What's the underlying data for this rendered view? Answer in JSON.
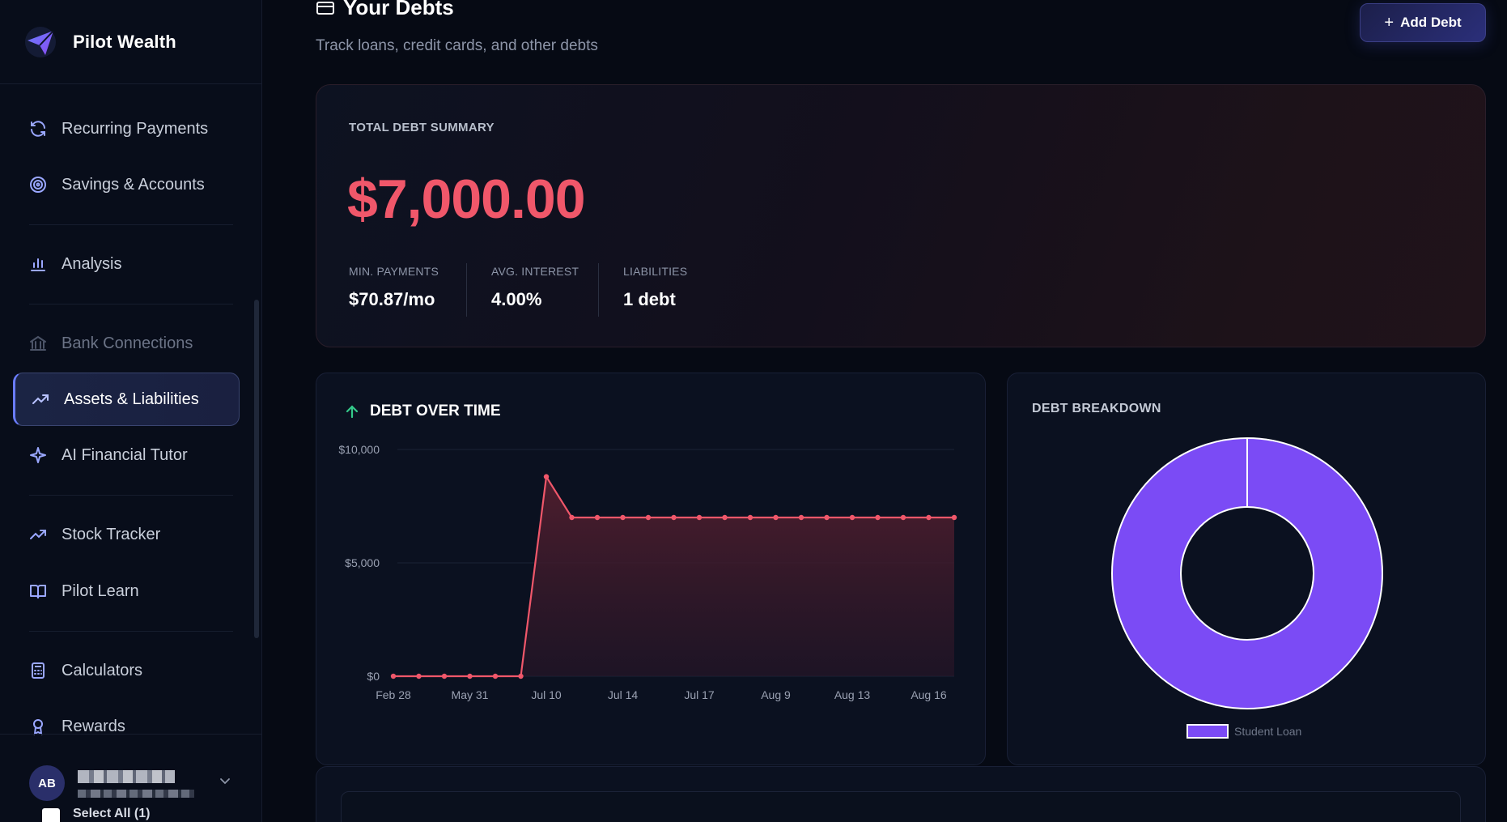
{
  "app": {
    "name": "Pilot Wealth"
  },
  "sidebar": {
    "items": [
      {
        "label": "Recurring Payments",
        "icon": "refresh-icon",
        "state": "normal"
      },
      {
        "label": "Savings & Accounts",
        "icon": "target-icon",
        "state": "normal"
      },
      {
        "label": "Analysis",
        "icon": "bar-chart-icon",
        "state": "normal"
      },
      {
        "label": "Bank Connections",
        "icon": "bank-icon",
        "state": "disabled"
      },
      {
        "label": "Assets & Liabilities",
        "icon": "trending-up-icon",
        "state": "active"
      },
      {
        "label": "AI Financial Tutor",
        "icon": "sparkle-icon",
        "state": "normal"
      },
      {
        "label": "Stock Tracker",
        "icon": "trending-up-icon",
        "state": "normal"
      },
      {
        "label": "Pilot Learn",
        "icon": "book-icon",
        "state": "normal"
      },
      {
        "label": "Calculators",
        "icon": "calculator-icon",
        "state": "normal"
      },
      {
        "label": "Rewards",
        "icon": "award-icon",
        "state": "normal"
      }
    ],
    "user": {
      "initials": "AB"
    }
  },
  "header": {
    "title": "Your Debts",
    "subtitle": "Track loans, credit cards, and other debts",
    "add_button": "Add Debt"
  },
  "summary": {
    "label": "TOTAL DEBT SUMMARY",
    "total": "$7,000.00",
    "stats": [
      {
        "label": "MIN. PAYMENTS",
        "value": "$70.87/mo"
      },
      {
        "label": "AVG. INTEREST",
        "value": "4.00%"
      },
      {
        "label": "LIABILITIES",
        "value": "1 debt"
      }
    ]
  },
  "debt_chart": {
    "title": "DEBT OVER TIME"
  },
  "breakdown": {
    "title": "DEBT BREAKDOWN"
  },
  "list": {
    "select_all": "Select All (1)"
  },
  "colors": {
    "accent": "#6a7cff",
    "debt_red": "#f0576a",
    "pie_purple": "#7b4bf5",
    "up_green": "#34c98a"
  },
  "chart_data": [
    {
      "type": "area",
      "title": "DEBT OVER TIME",
      "x": [
        "Feb 28",
        "",
        "",
        "May 31",
        "",
        "Jul 10",
        "",
        "",
        "Jul 14",
        "",
        "",
        "Jul 17",
        "",
        "",
        "Aug 9",
        "",
        "",
        "Aug 13",
        "",
        "",
        "Aug 16",
        ""
      ],
      "x_ticks": [
        "Feb 28",
        "May 31",
        "Jul 10",
        "Jul 14",
        "Jul 17",
        "Aug 9",
        "Aug 13",
        "Aug 16"
      ],
      "y_ticks": [
        "$10,000",
        "$5,000",
        "$0"
      ],
      "ylim": [
        0,
        10000
      ],
      "series": [
        {
          "values": [
            0,
            0,
            0,
            0,
            0,
            0,
            8800,
            7000,
            7000,
            7000,
            7000,
            7000,
            7000,
            7000,
            7000,
            7000,
            7000,
            7000,
            7000,
            7000,
            7000,
            7000,
            7000
          ]
        }
      ],
      "grid": true
    },
    {
      "type": "pie",
      "title": "DEBT BREAKDOWN",
      "categories": [
        "Student Loan"
      ],
      "values": [
        7000
      ],
      "legend": "bottom"
    }
  ]
}
